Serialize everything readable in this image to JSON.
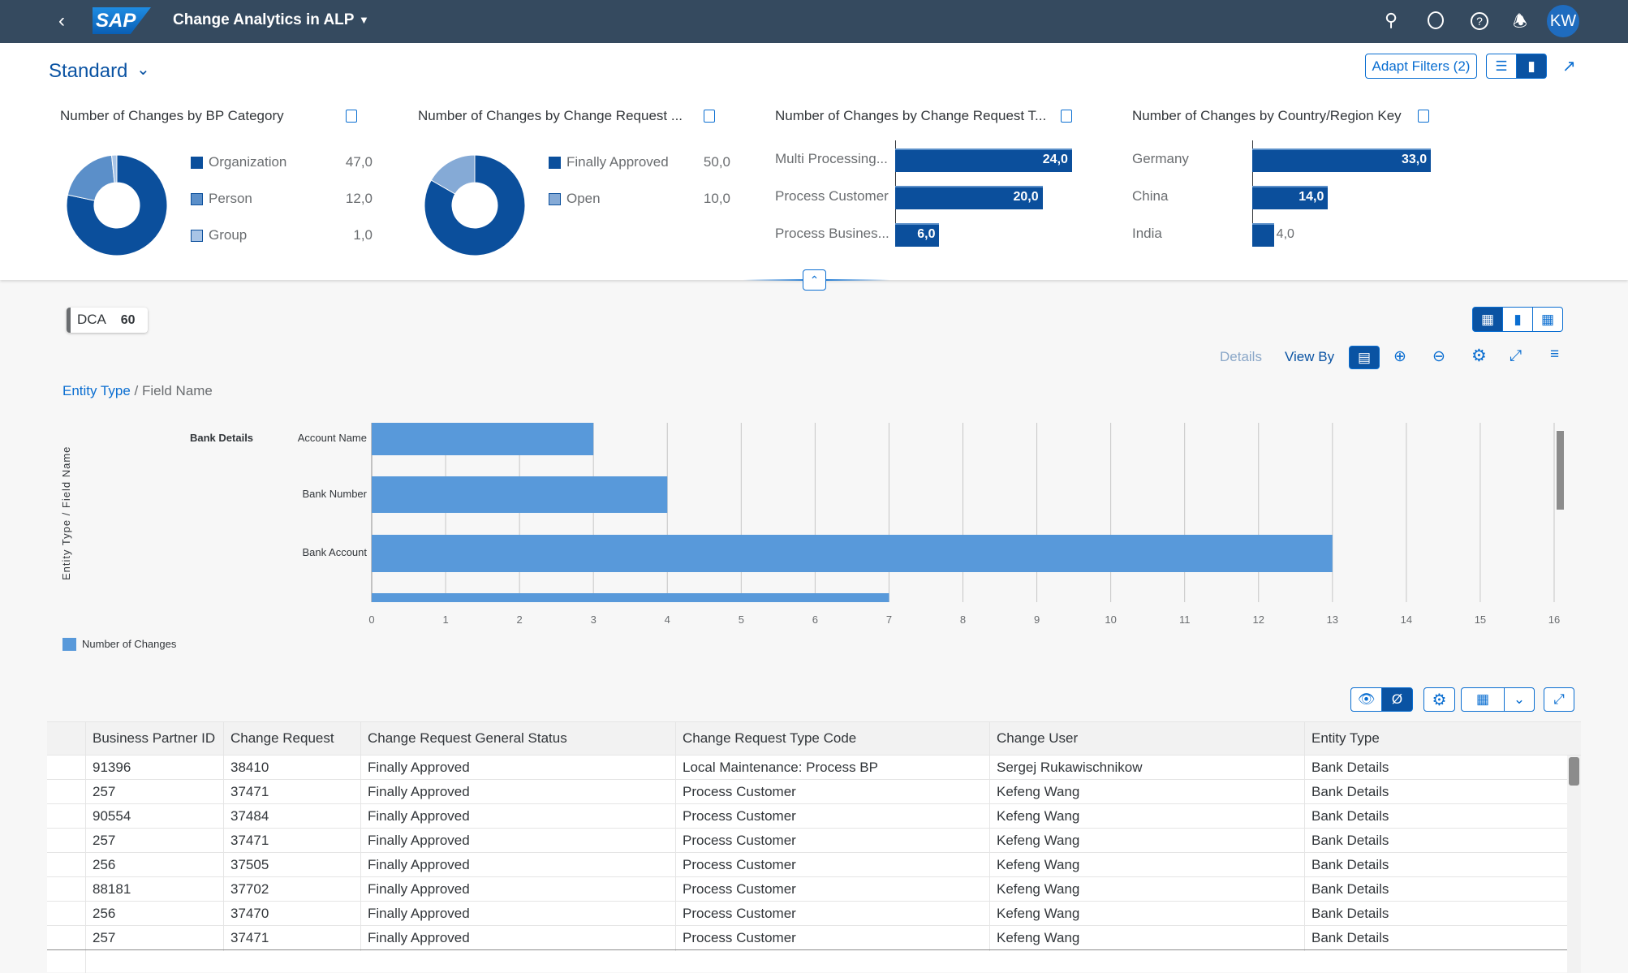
{
  "shell": {
    "title": "Change Analytics in ALP",
    "avatar": "KW",
    "logo": "SAP",
    "icons": [
      "back-icon",
      "search-icon",
      "copilot-icon",
      "help-icon",
      "bell-icon"
    ]
  },
  "header": {
    "variant": "Standard",
    "adapt_filters": "Adapt Filters (2)"
  },
  "kpis": [
    {
      "title": "Number of Changes by BP Category",
      "type": "donut",
      "items": [
        {
          "label": "Organization",
          "value": 47,
          "text": "47,0",
          "color": "#0b4f9c"
        },
        {
          "label": "Person",
          "value": 12,
          "text": "12,0",
          "color": "#5b8fc9"
        },
        {
          "label": "Group",
          "value": 1,
          "text": "1,0",
          "color": "#a8c4e6"
        }
      ]
    },
    {
      "title": "Number of Changes by Change Request ...",
      "type": "donut",
      "items": [
        {
          "label": "Finally Approved",
          "value": 50,
          "text": "50,0",
          "color": "#0b4f9c"
        },
        {
          "label": "Open",
          "value": 10,
          "text": "10,0",
          "color": "#85aad6"
        }
      ]
    },
    {
      "title": "Number of Changes by Change Request T...",
      "type": "bar",
      "items": [
        {
          "label": "Multi Processing...",
          "value": 24,
          "text": "24,0"
        },
        {
          "label": "Process Customer",
          "value": 20,
          "text": "20,0"
        },
        {
          "label": "Process Busines...",
          "value": 6,
          "text": "6,0"
        }
      ]
    },
    {
      "title": "Number of Changes by Country/Region Key",
      "type": "bar",
      "items": [
        {
          "label": "Germany",
          "value": 33,
          "text": "33,0"
        },
        {
          "label": "China",
          "value": 14,
          "text": "14,0"
        },
        {
          "label": "India",
          "value": 4,
          "text": "4,0"
        }
      ]
    }
  ],
  "chip": {
    "label": "DCA",
    "count": "60"
  },
  "toolbar": {
    "details": "Details",
    "view_by": "View By"
  },
  "breadcrumb": {
    "link": "Entity Type",
    "rest": " / Field Name"
  },
  "chart_data": {
    "type": "bar",
    "orientation": "horizontal",
    "group": "Bank Details",
    "categories": [
      "Account Name",
      "Bank Number",
      "Bank Account",
      ""
    ],
    "values": [
      3,
      4,
      13,
      7
    ],
    "ylabel": "Entity Type / Field Name",
    "xlim": [
      0,
      16
    ],
    "ticks": [
      "0",
      "1",
      "2",
      "3",
      "4",
      "5",
      "6",
      "7",
      "8",
      "9",
      "10",
      "11",
      "12",
      "13",
      "14",
      "15",
      "16"
    ],
    "legend": "Number of Changes",
    "color": "#5899da",
    "grid": true
  },
  "table": {
    "columns": [
      "Business Partner ID",
      "Change Request",
      "Change Request General Status",
      "Change Request Type Code",
      "Change User",
      "Entity Type"
    ],
    "rows": [
      [
        "91396",
        "38410",
        "Finally Approved",
        "Local Maintenance: Process BP",
        "Sergej Rukawischnikow",
        "Bank Details"
      ],
      [
        "257",
        "37471",
        "Finally Approved",
        "Process Customer",
        "Kefeng Wang",
        "Bank Details"
      ],
      [
        "90554",
        "37484",
        "Finally Approved",
        "Process Customer",
        "Kefeng Wang",
        "Bank Details"
      ],
      [
        "257",
        "37471",
        "Finally Approved",
        "Process Customer",
        "Kefeng Wang",
        "Bank Details"
      ],
      [
        "256",
        "37505",
        "Finally Approved",
        "Process Customer",
        "Kefeng Wang",
        "Bank Details"
      ],
      [
        "88181",
        "37702",
        "Finally Approved",
        "Process Customer",
        "Kefeng Wang",
        "Bank Details"
      ],
      [
        "256",
        "37470",
        "Finally Approved",
        "Process Customer",
        "Kefeng Wang",
        "Bank Details"
      ],
      [
        "257",
        "37471",
        "Finally Approved",
        "Process Customer",
        "Kefeng Wang",
        "Bank Details"
      ]
    ]
  }
}
